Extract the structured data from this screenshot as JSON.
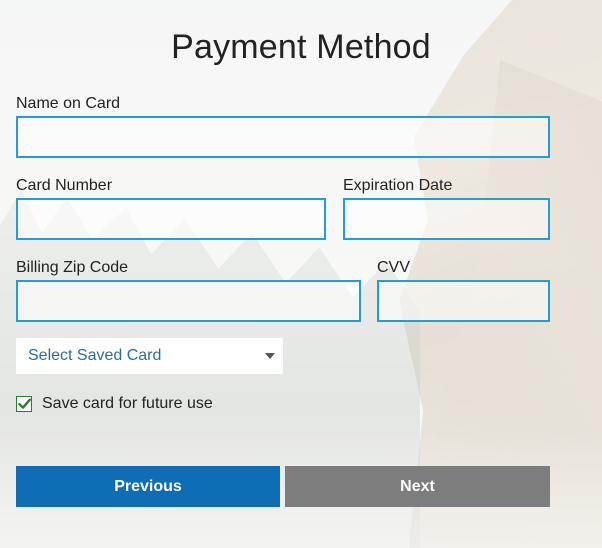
{
  "title": "Payment Method",
  "fields": {
    "name_on_card": {
      "label": "Name on Card",
      "value": ""
    },
    "card_number": {
      "label": "Card Number",
      "value": ""
    },
    "expiration_date": {
      "label": "Expiration Date",
      "value": ""
    },
    "billing_zip": {
      "label": "Billing Zip Code",
      "value": ""
    },
    "cvv": {
      "label": "CVV",
      "value": ""
    }
  },
  "saved_card_select": {
    "selected": "Select Saved Card"
  },
  "save_card_checkbox": {
    "label": "Save card for future use",
    "checked": true
  },
  "buttons": {
    "previous": "Previous",
    "next": "Next"
  },
  "colors": {
    "input_border": "#1f9fd6",
    "primary_button": "#0f6db5",
    "secondary_button": "#7d7d7d",
    "select_text": "#2c6c9d",
    "checkbox_check": "#2e7d32"
  },
  "icons": {
    "select_caret": "caret-down-icon",
    "checkbox_check": "checkmark-icon"
  }
}
